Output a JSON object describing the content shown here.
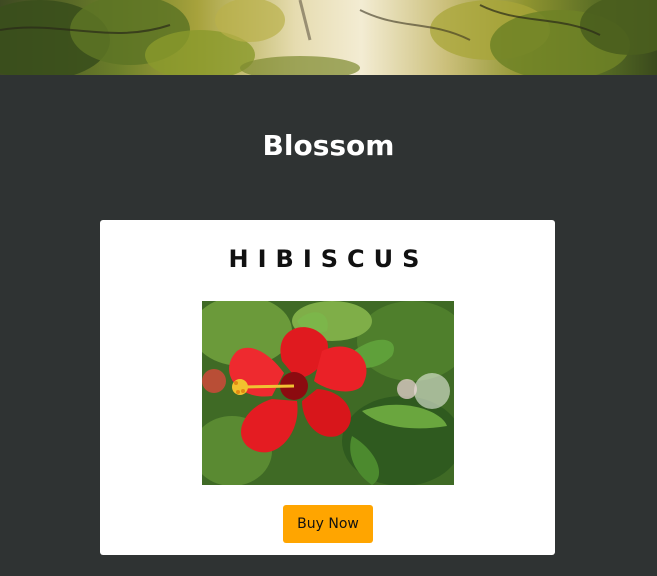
{
  "header": {
    "title": "Blossom"
  },
  "product": {
    "name": "HIBISCUS",
    "image_alt": "hibiscus-flower-photo",
    "buy_label": "Buy Now"
  },
  "colors": {
    "background": "#2f3333",
    "card": "#ffffff",
    "button": "#ffa500",
    "title_text": "#ffffff"
  }
}
